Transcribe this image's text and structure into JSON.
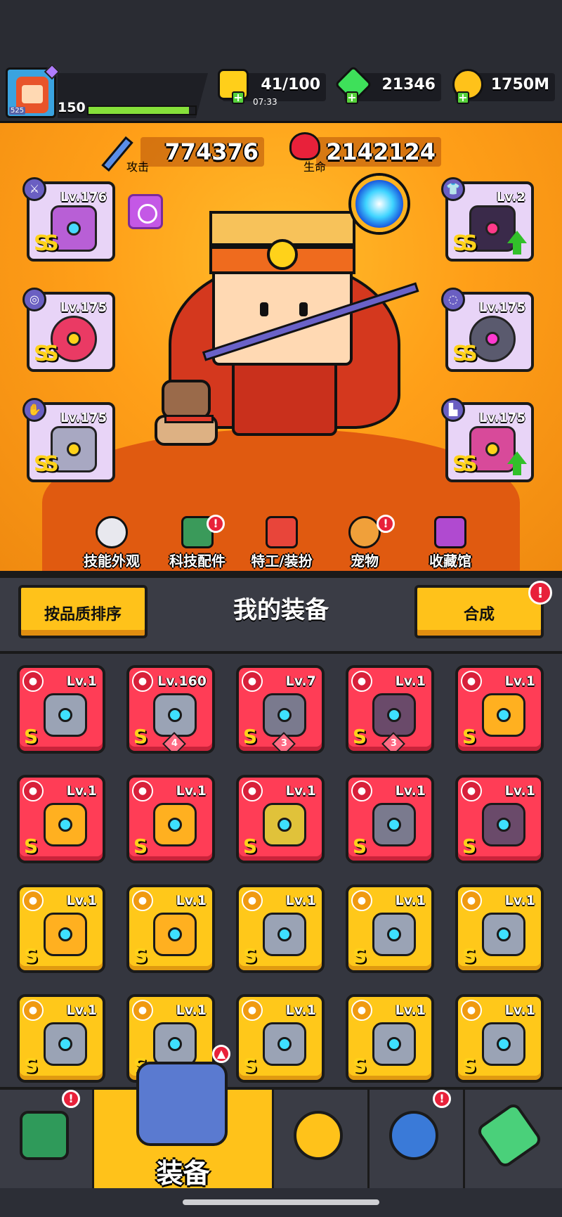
{
  "hud": {
    "player_level_badge": "525",
    "exp_level": "150",
    "exp_fill": 0.94,
    "energy": "41/100",
    "energy_timer": "07:33",
    "gems": "21346",
    "gold": "1750M",
    "plus_symbol": "+"
  },
  "stats": {
    "attack_value": "774376",
    "attack_label": "攻击",
    "hp_value": "2142124",
    "hp_label": "生命"
  },
  "equipped": {
    "weapon": {
      "level": "Lv.176",
      "grade": "SS",
      "icon": "weapon-icon"
    },
    "necklace": {
      "level": "Lv.175",
      "grade": "SS",
      "icon": "necklace-icon"
    },
    "gloves": {
      "level": "Lv.175",
      "grade": "SS",
      "icon": "glove-icon"
    },
    "armor": {
      "level": "Lv.2",
      "grade": "SS",
      "icon": "armor-icon",
      "upgrade": true
    },
    "belt": {
      "level": "Lv.175",
      "grade": "SS",
      "icon": "belt-icon"
    },
    "boots": {
      "level": "Lv.175",
      "grade": "SS",
      "icon": "boots-icon",
      "upgrade": true
    }
  },
  "menu": [
    {
      "label": "技能外观",
      "alert": false
    },
    {
      "label": "科技配件",
      "alert": true
    },
    {
      "label": "特工/装扮",
      "alert": false
    },
    {
      "label": "宠物",
      "alert": true
    },
    {
      "label": "收藏馆",
      "alert": false
    }
  ],
  "alert_symbol": "!",
  "equip_section": {
    "sort_button": "按品质排序",
    "title": "我的装备",
    "merge_button": "合成"
  },
  "inventory": [
    {
      "level": "Lv.1",
      "grade": "S",
      "rarity": "red",
      "icon": "armor-icon"
    },
    {
      "level": "Lv.160",
      "grade": "S",
      "rarity": "red",
      "icon": "armor-icon",
      "count": "4"
    },
    {
      "level": "Lv.7",
      "grade": "S",
      "rarity": "red",
      "icon": "belt-icon",
      "count": "3"
    },
    {
      "level": "Lv.1",
      "grade": "S",
      "rarity": "red",
      "icon": "boots-icon",
      "count": "3"
    },
    {
      "level": "Lv.1",
      "grade": "S",
      "rarity": "red",
      "icon": "weapon-icon"
    },
    {
      "level": "Lv.1",
      "grade": "S",
      "rarity": "red",
      "icon": "weapon-icon"
    },
    {
      "level": "Lv.1",
      "grade": "S",
      "rarity": "red",
      "icon": "weapon-icon"
    },
    {
      "level": "Lv.1",
      "grade": "S",
      "rarity": "red",
      "icon": "necklace-icon"
    },
    {
      "level": "Lv.1",
      "grade": "S",
      "rarity": "red",
      "icon": "belt-icon"
    },
    {
      "level": "Lv.1",
      "grade": "S",
      "rarity": "red",
      "icon": "boots-icon"
    },
    {
      "level": "Lv.1",
      "grade": "S",
      "rarity": "yellow",
      "icon": "weapon-icon"
    },
    {
      "level": "Lv.1",
      "grade": "S",
      "rarity": "yellow",
      "icon": "weapon-icon"
    },
    {
      "level": "Lv.1",
      "grade": "S",
      "rarity": "yellow",
      "icon": "armor-icon"
    },
    {
      "level": "Lv.1",
      "grade": "S",
      "rarity": "yellow",
      "icon": "armor-icon"
    },
    {
      "level": "Lv.1",
      "grade": "S",
      "rarity": "yellow",
      "icon": "armor-icon"
    },
    {
      "level": "Lv.1",
      "grade": "S",
      "rarity": "yellow",
      "icon": "armor-icon"
    },
    {
      "level": "Lv.1",
      "grade": "S",
      "rarity": "yellow",
      "icon": "armor-icon"
    },
    {
      "level": "Lv.1",
      "grade": "S",
      "rarity": "yellow",
      "icon": "armor-icon"
    },
    {
      "level": "Lv.1",
      "grade": "S",
      "rarity": "yellow",
      "icon": "armor-icon"
    },
    {
      "level": "Lv.1",
      "grade": "S",
      "rarity": "yellow",
      "icon": "armor-icon"
    }
  ],
  "nav": {
    "active_label": "装备",
    "tabs": [
      "shop-icon",
      "equipment-icon",
      "star-swords-icon",
      "planet-icon",
      "dna-icon"
    ]
  },
  "colors": {
    "rarity_red": "#ff3d56",
    "rarity_yellow": "#ffc81a",
    "accent_yellow": "#ffc21a",
    "alert_red": "#e8213a"
  }
}
